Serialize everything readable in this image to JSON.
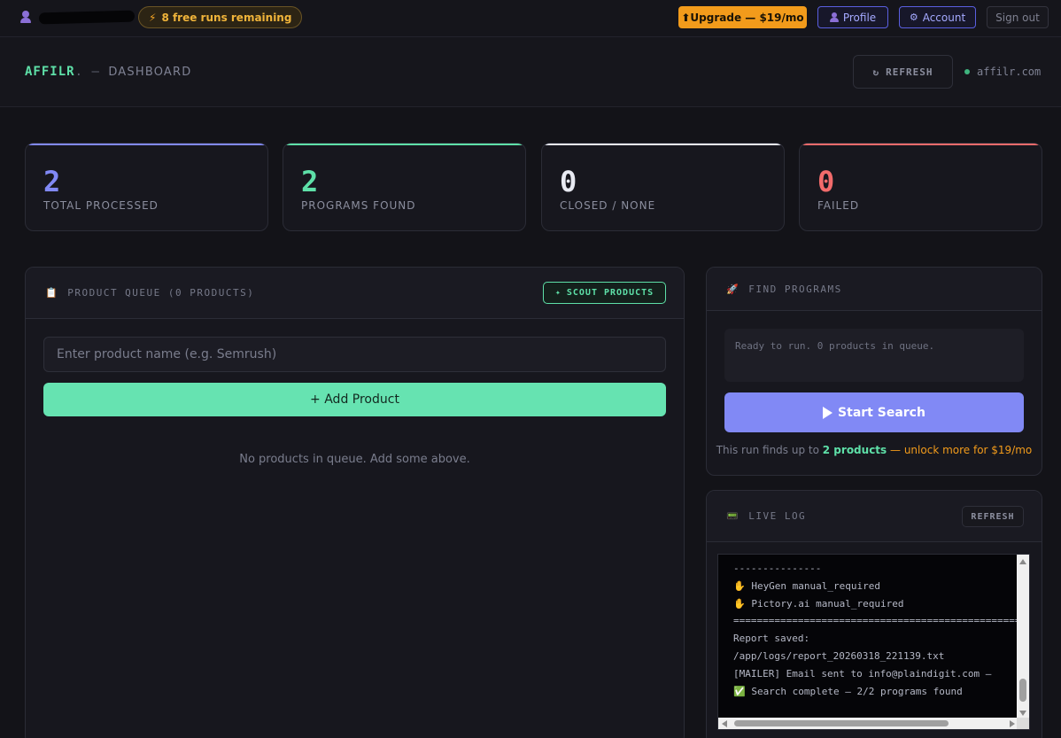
{
  "topbar": {
    "user_icon": "person-icon",
    "runs_badge": "8 free runs remaining",
    "runs_icon": "lightning-icon",
    "upgrade_label": "⬆Upgrade — $19/mo",
    "profile_label": "Profile",
    "account_label": "Account",
    "signout_label": "Sign out"
  },
  "header": {
    "logo": "AFFILR",
    "logo_dot": ".",
    "separator": "—",
    "section": "DASHBOARD",
    "refresh_label": "REFRESH",
    "domain": "affilr.com"
  },
  "stats": [
    {
      "value": "2",
      "label": "TOTAL PROCESSED",
      "color": "#8189f5"
    },
    {
      "value": "2",
      "label": "PROGRAMS FOUND",
      "color": "#5ee0a8"
    },
    {
      "value": "0",
      "label": "CLOSED / NONE",
      "color": "#e8eaf2"
    },
    {
      "value": "0",
      "label": "FAILED",
      "color": "#f26b6b"
    }
  ],
  "queue": {
    "title": "PRODUCT QUEUE (0 PRODUCTS)",
    "scout_label": "SCOUT PRODUCTS",
    "input_placeholder": "Enter product name (e.g. Semrush)",
    "add_label": "+ Add Product",
    "empty_message": "No products in queue. Add some above."
  },
  "find": {
    "title": "FIND PROGRAMS",
    "status": "Ready to run. 0 products in queue.",
    "start_label": "Start Search",
    "note_prefix": "This run finds up to",
    "note_count": "2 products",
    "note_upsell": "— unlock more for $19/mo"
  },
  "log": {
    "title": "LIVE LOG",
    "refresh_label": "REFRESH",
    "lines": [
      "---------------",
      "✋ HeyGen manual_required",
      "✋ Pictory.ai manual_required",
      "==================================================",
      "Report saved:",
      "/app/logs/report_20260318_221139.txt",
      "[MAILER] Email sent to info@plaindigit.com —",
      "✅ Search complete — 2/2 programs found"
    ]
  },
  "colors": {
    "accent_green": "#5ee0a8",
    "accent_purple": "#8189f5",
    "accent_orange": "#f29b1b",
    "accent_red": "#f26b6b",
    "background": "#131318"
  }
}
